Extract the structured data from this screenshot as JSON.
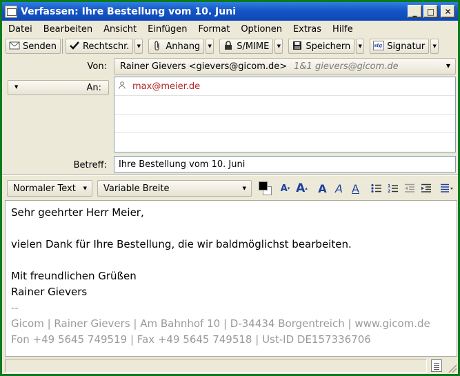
{
  "window": {
    "title": "Verfassen: Ihre Bestellung vom 10. Juni",
    "minimize_glyph": "_",
    "maximize_glyph": "□",
    "close_glyph": "✕"
  },
  "menu": [
    "Datei",
    "Bearbeiten",
    "Ansicht",
    "Einfügen",
    "Format",
    "Optionen",
    "Extras",
    "Hilfe"
  ],
  "toolbar": {
    "send": "Senden",
    "spell": "Rechtschr.",
    "attach": "Anhang",
    "smime": "S/MIME",
    "save": "Speichern",
    "signature": "Signatur"
  },
  "header": {
    "from_label": "Von:",
    "from_value": "Rainer Gievers <gievers@gicom.de>",
    "from_identity": "1&1 gievers@gicom.de",
    "to_label": "An:",
    "recipients": [
      "max@meier.de",
      "",
      "",
      ""
    ],
    "subject_label": "Betreff:",
    "subject_value": "Ihre Bestellung vom 10. Juni"
  },
  "format": {
    "paragraph_style": "Normaler Text",
    "font": "Variable Breite"
  },
  "body": {
    "greeting": "Sehr geehrter Herr Meier,",
    "line1": "vielen Dank für Ihre Bestellung, die wir baldmöglichst bearbeiten.",
    "closing": "Mit freundlichen Grüßen",
    "name": "Rainer Gievers",
    "sig_sep": "--",
    "sig_line1": "Gicom | Rainer Gievers | Am Bahnhof 10 | D-34434 Borgentreich | www.gicom.de",
    "sig_line2": "Fon +49 5645 749519 | Fax +49 5645 749518 | Ust-ID DE157336706"
  },
  "colors": {
    "titlebar": "#1656c7",
    "recipient": "#b22222",
    "signature": "#9a9a9a",
    "format_icons": "#1b3f9e"
  }
}
